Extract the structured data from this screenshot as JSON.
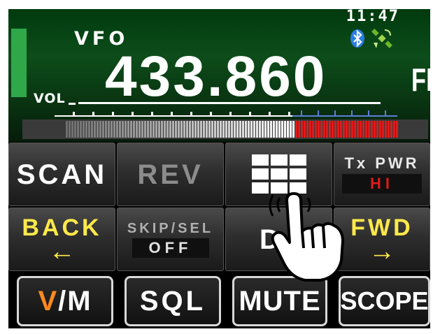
{
  "display": {
    "clock": "11:47",
    "mode": "VFO",
    "frequency": "433.860",
    "modulation": "FM",
    "volume_label": "VOL",
    "icons": [
      "bluetooth-icon",
      "gps-satellite-icon"
    ]
  },
  "keys": {
    "scan": "SCAN",
    "rev": "REV",
    "menu_icon": "grid-menu-icon",
    "tx_pwr_label": "Tx PWR",
    "tx_pwr_value": "HI",
    "back": "BACK",
    "back_arrow": "←",
    "skip_sel_label": "SKIP/SEL",
    "skip_sel_value": "OFF",
    "d_key": "D",
    "fwd": "FWD",
    "fwd_arrow": "→",
    "vm_v": "V",
    "vm_rest": "/M",
    "sql": "SQL",
    "mute": "MUTE",
    "scope": "SCOPE"
  },
  "colors": {
    "accent_yellow": "#ffe94a",
    "accent_orange": "#ff8a1e",
    "meter_red": "#e01a1a",
    "display_green": "#0d4d1a",
    "vol_green": "#2fa84a"
  }
}
